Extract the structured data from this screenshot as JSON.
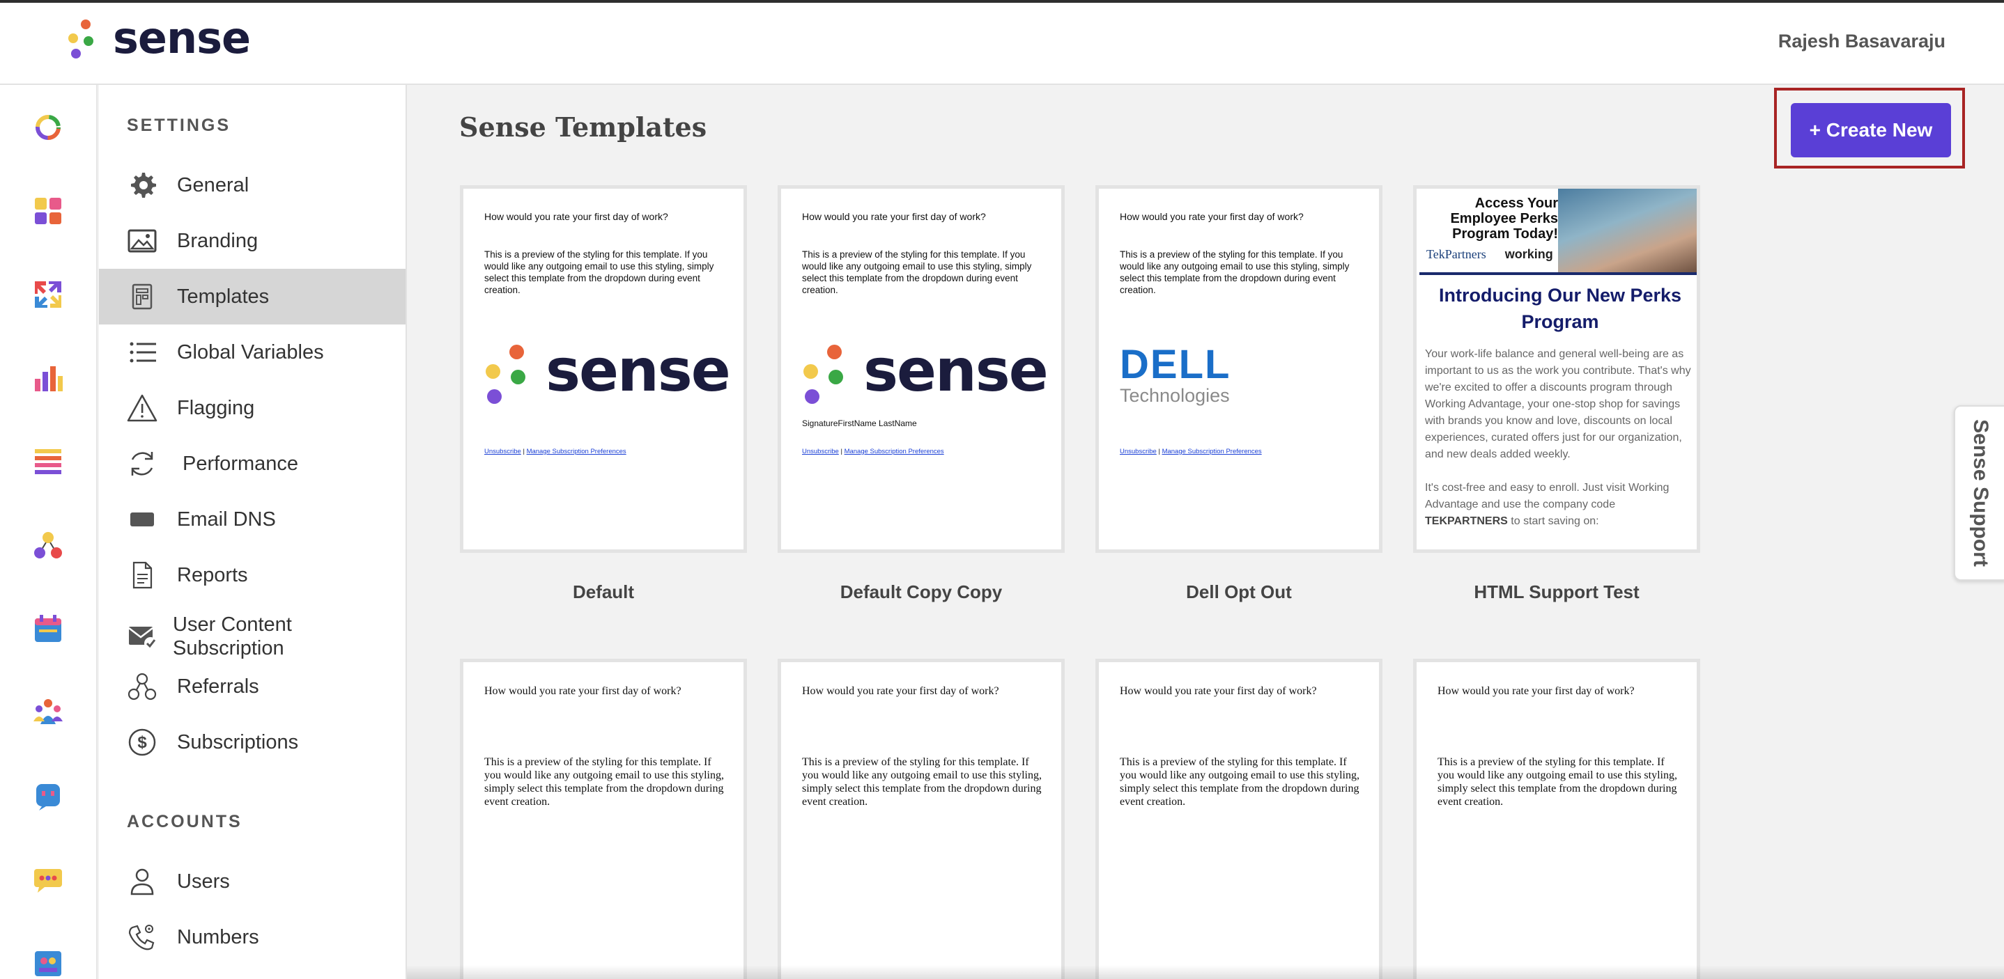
{
  "app": {
    "logo_text": "sense",
    "user_name": "Rajesh Basavaraju"
  },
  "rail": {
    "items": [
      "dashboard-icon",
      "apps-icon",
      "sync-arrows-icon",
      "bar-chart-icon",
      "list-icon",
      "people-network-icon",
      "calendar-icon",
      "team-icon",
      "chatbot-icon",
      "chat-bubble-icon",
      "contacts-icon"
    ]
  },
  "sidebar": {
    "settings_title": "SETTINGS",
    "items": [
      {
        "label": "General",
        "icon": "gear-icon"
      },
      {
        "label": "Branding",
        "icon": "image-icon"
      },
      {
        "label": "Templates",
        "icon": "template-icon"
      },
      {
        "label": "Global Variables",
        "icon": "list-icon"
      },
      {
        "label": "Flagging",
        "icon": "warning-icon"
      },
      {
        "label": "Performance",
        "icon": "refresh-icon"
      },
      {
        "label": "Email DNS",
        "icon": "rectangle-icon"
      },
      {
        "label": "Reports",
        "icon": "document-icon"
      },
      {
        "label": "User Content Subscription",
        "icon": "mail-check-icon"
      },
      {
        "label": "Referrals",
        "icon": "network-icon"
      },
      {
        "label": "Subscriptions",
        "icon": "dollar-icon"
      }
    ],
    "accounts_title": "ACCOUNTS",
    "account_items": [
      {
        "label": "Users",
        "icon": "user-icon"
      },
      {
        "label": "Numbers",
        "icon": "phone-gear-icon"
      }
    ],
    "active_item": "Templates"
  },
  "main": {
    "title": "Sense Templates",
    "create_button": "+ Create New"
  },
  "templates": {
    "preview_question": "How would you rate your first day of work?",
    "preview_body": "This is a preview of the styling for this template. If you would like any outgoing email to use this styling, simply select this template from the dropdown during event creation.",
    "unsubscribe": "Unsubscribe",
    "separator": "|",
    "manage_prefs": "Manage Subscription Preferences",
    "signature": "SignatureFirstName LastName",
    "logo_word": "sense",
    "dell_word": "DELL",
    "dell_sub": "Technologies",
    "cards": [
      {
        "name": "Default"
      },
      {
        "name": "Default Copy Copy"
      },
      {
        "name": "Dell Opt Out"
      },
      {
        "name": "HTML Support Test"
      }
    ],
    "html_card": {
      "banner_text": "Access Your Employee Perks Program Today!",
      "logo_tekpartners": "TekPartners",
      "logo_working": "working",
      "heading": "Introducing Our New Perks Program",
      "para1": "Your work-life balance and general well-being are as important to us as the work you contribute. That's why we're excited to offer a discounts program through Working Advantage, your one-stop shop for savings with brands you know and love, discounts on local experiences, curated offers just for our organization, and new deals added weekly.",
      "para2_pre": "It's cost-free and easy to enroll. Just visit Working Advantage and use the company code",
      "para2_code": "TEKPARTNERS",
      "para2_post": "to start saving on:"
    }
  },
  "support": {
    "label": "Sense Support"
  },
  "colors": {
    "accent": "#5a3fd6",
    "highlight_border": "#a82424",
    "logo_dark": "#1b1c3d",
    "dot_orange": "#e8643a",
    "dot_yellow": "#f2c94c",
    "dot_green": "#3aa845",
    "dot_purple": "#7b4fd6"
  }
}
